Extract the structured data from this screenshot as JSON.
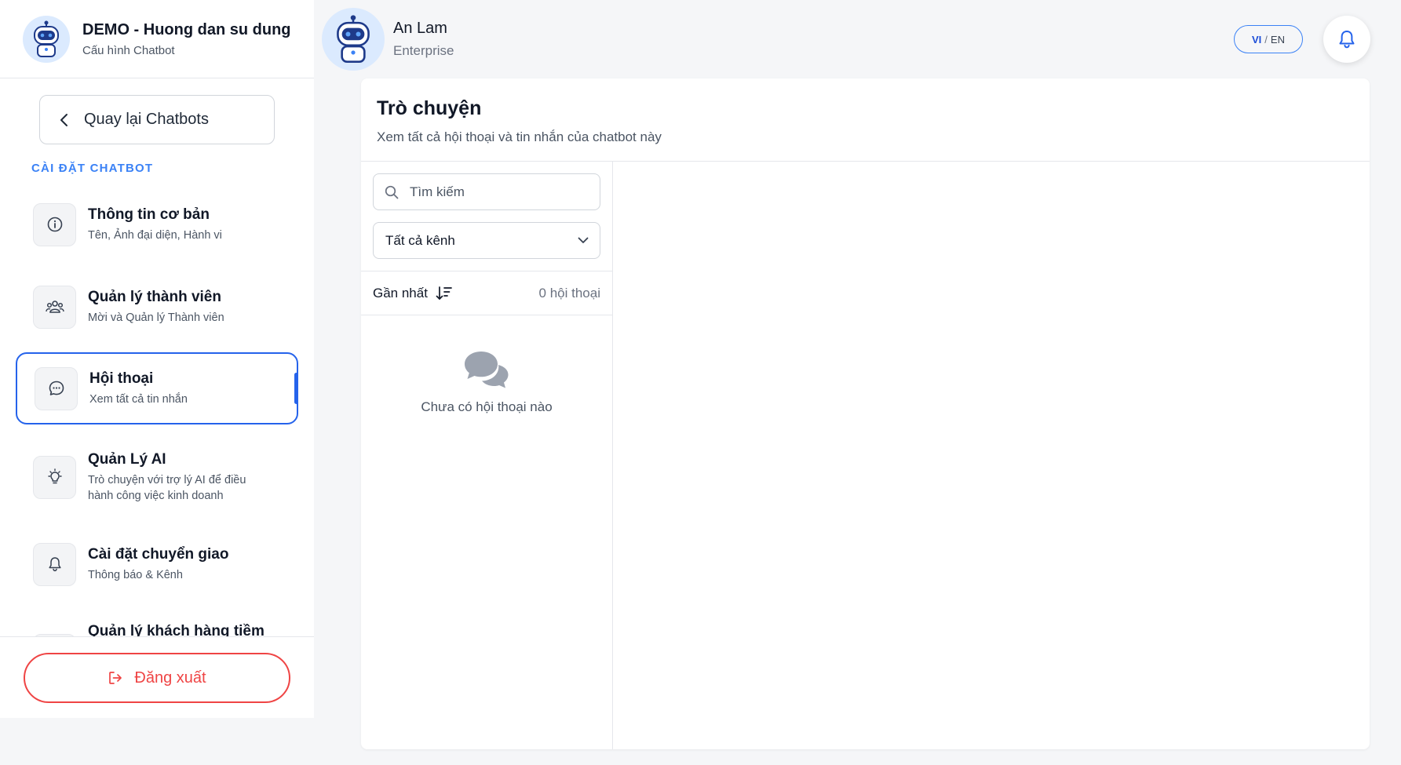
{
  "sidebar": {
    "title": "DEMO - Huong dan su dung",
    "subtitle": "Cấu hình Chatbot",
    "back_label": "Quay lại Chatbots",
    "section_label": "CÀI ĐẶT CHATBOT",
    "items": [
      {
        "title": "Thông tin cơ bản",
        "subtitle": "Tên, Ảnh đại diện, Hành vi",
        "icon": "info-icon"
      },
      {
        "title": "Quản lý thành viên",
        "subtitle": "Mời và Quản lý Thành viên",
        "icon": "users-icon"
      },
      {
        "title": "Hội thoại",
        "subtitle": "Xem tất cả tin nhắn",
        "icon": "chat-bubble-icon",
        "active": true
      },
      {
        "title": "Quản Lý AI",
        "subtitle": "Trò chuyện với trợ lý AI để điều hành công việc kinh doanh",
        "icon": "lightbulb-icon"
      },
      {
        "title": "Cài đặt chuyển giao",
        "subtitle": "Thông báo & Kênh",
        "icon": "bell-icon"
      },
      {
        "title": "Quản lý khách hàng tiềm"
      }
    ],
    "logout_label": "Đăng xuất"
  },
  "header": {
    "user_name": "An Lam",
    "user_plan": "Enterprise",
    "lang_vi": "VI",
    "lang_sep": "/",
    "lang_en": "EN"
  },
  "main": {
    "title": "Trò chuyện",
    "subtitle": "Xem tất cả hội thoại và tin nhắn của chatbot này",
    "search_placeholder": "Tìm kiếm",
    "channel_value": "Tất cả kênh",
    "sort_label": "Gần nhất",
    "count_label": "0 hội thoại",
    "empty_text": "Chưa có hội thoại nào"
  },
  "colors": {
    "accent": "#2563eb",
    "danger": "#ef4444",
    "section_label": "#3b82f6"
  }
}
